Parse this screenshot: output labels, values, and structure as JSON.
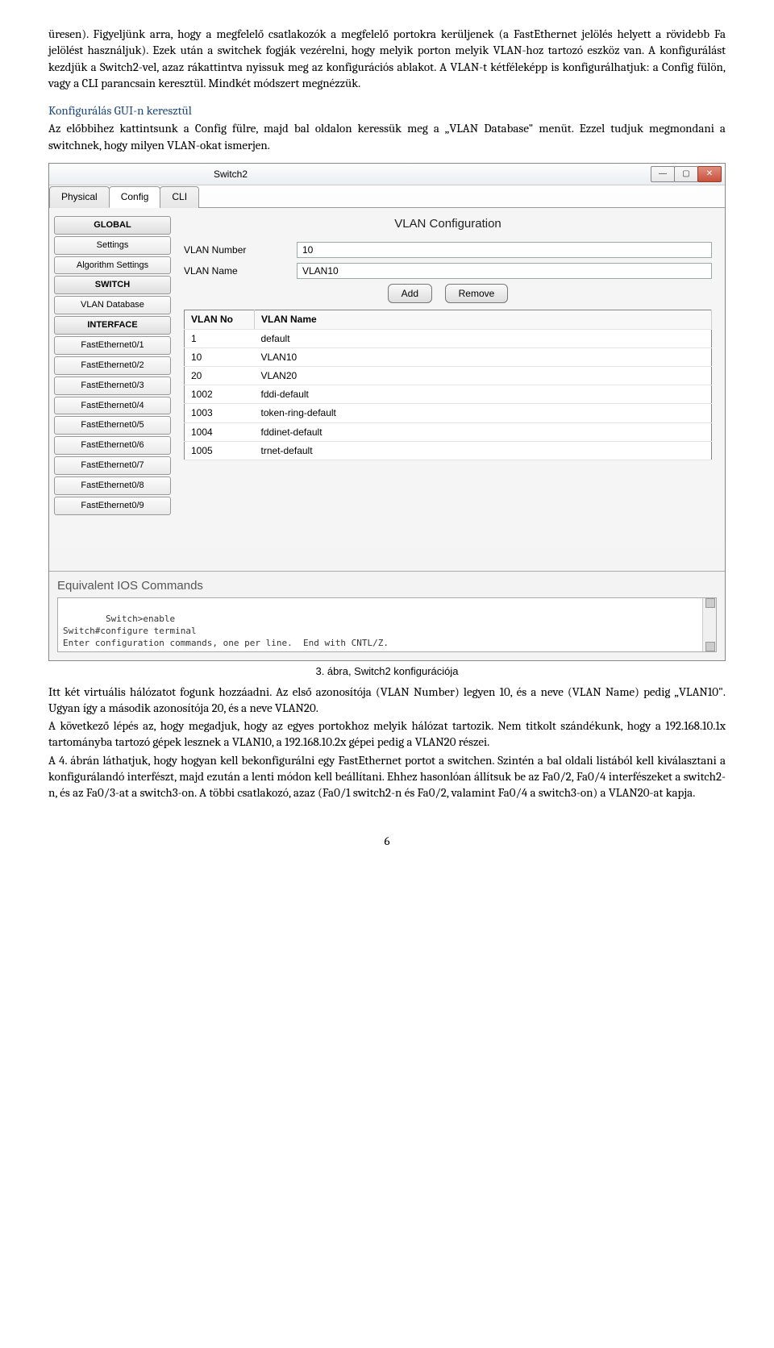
{
  "para1": "üresen). Figyeljünk arra, hogy a megfelelő csatlakozók a megfelelő portokra kerüljenek (a FastEthernet jelölés helyett a rövidebb Fa jelölést használjuk). Ezek után a switchek fogják vezérelni, hogy melyik porton melyik VLAN-hoz tartozó eszköz van. A konfigurálást kezdjük a Switch2-vel, azaz rákattintva nyissuk meg az konfigurációs ablakot. A VLAN-t kétféleképp is konfigurálhatjuk: a Config fülön, vagy a CLI parancsain keresztül. Mindkét módszert megnézzük.",
  "heading1": "Konfigurálás GUI-n keresztül",
  "para2": "Az előbbihez kattintsunk a Config fülre, majd bal oldalon keressük meg a „VLAN Database\" menüt. Ezzel tudjuk megmondani a switchnek, hogy milyen VLAN-okat ismerjen.",
  "window": {
    "title": "Switch2",
    "tabs": {
      "physical": "Physical",
      "config": "Config",
      "cli": "CLI"
    },
    "sidebar": {
      "global": "GLOBAL",
      "settings": "Settings",
      "algorithm": "Algorithm Settings",
      "switch": "SWITCH",
      "vlandb": "VLAN Database",
      "interface": "INTERFACE",
      "ports": [
        "FastEthernet0/1",
        "FastEthernet0/2",
        "FastEthernet0/3",
        "FastEthernet0/4",
        "FastEthernet0/5",
        "FastEthernet0/6",
        "FastEthernet0/7",
        "FastEthernet0/8",
        "FastEthernet0/9"
      ]
    },
    "panel": {
      "title": "VLAN Configuration",
      "label_num": "VLAN Number",
      "val_num": "10",
      "label_name": "VLAN Name",
      "val_name": "VLAN10",
      "add": "Add",
      "remove": "Remove",
      "th_no": "VLAN No",
      "th_name": "VLAN Name",
      "rows": [
        {
          "no": "1",
          "name": "default"
        },
        {
          "no": "10",
          "name": "VLAN10"
        },
        {
          "no": "20",
          "name": "VLAN20"
        },
        {
          "no": "1002",
          "name": "fddi-default"
        },
        {
          "no": "1003",
          "name": "token-ring-default"
        },
        {
          "no": "1004",
          "name": "fddinet-default"
        },
        {
          "no": "1005",
          "name": "trnet-default"
        }
      ]
    },
    "ios": {
      "title": "Equivalent IOS Commands",
      "lines": "Switch>enable\nSwitch#configure terminal\nEnter configuration commands, one per line.  End with CNTL/Z.\nSwitch(config)#"
    }
  },
  "caption": "3. ábra, Switch2 konfigurációja",
  "para3": "Itt két virtuális hálózatot fogunk hozzáadni. Az első azonosítója (VLAN Number) legyen 10, és a neve (VLAN Name) pedig „VLAN10\". Ugyan így a második azonosítója 20, és a neve VLAN20.",
  "para4": "A következő lépés az, hogy megadjuk, hogy az egyes portokhoz melyik hálózat tartozik. Nem titkolt szándékunk, hogy a 192.168.10.1x tartományba tartozó gépek lesznek a VLAN10, a 192.168.10.2x gépei pedig a VLAN20 részei.",
  "para5": "A 4. ábrán láthatjuk, hogy hogyan kell bekonfigurálni egy FastEthernet portot a switchen. Szintén a bal oldali listából kell kiválasztani a konfigurálandó interfészt, majd ezután a lenti módon kell beállítani. Ehhez hasonlóan állítsuk be az Fa0/2, Fa0/4 interfészeket a switch2-n, és az Fa0/3-at a switch3-on. A többi csatlakozó, azaz (Fa0/1 switch2-n és Fa0/2, valamint Fa0/4 a switch3-on) a VLAN20-at kapja.",
  "page": "6"
}
